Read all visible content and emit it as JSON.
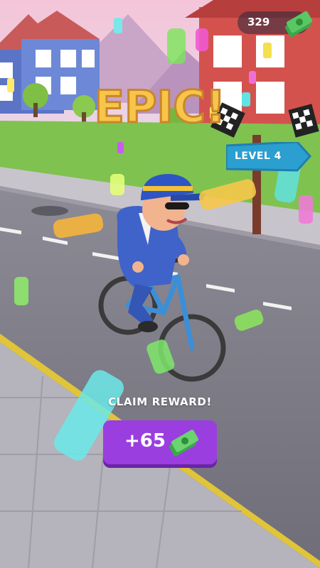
{
  "hud": {
    "cash_value": "329",
    "cash_icon": "cash-stack-icon"
  },
  "banner": {
    "text": "EPIC!"
  },
  "level_sign": {
    "text": "LEVEL 4"
  },
  "reward": {
    "label": "CLAIM REWARD!",
    "amount": "+65",
    "icon": "cash-stack-icon"
  },
  "colors": {
    "button": "#9a3ee0",
    "banner": "#f2b23a",
    "sign": "#2a9fd0"
  }
}
